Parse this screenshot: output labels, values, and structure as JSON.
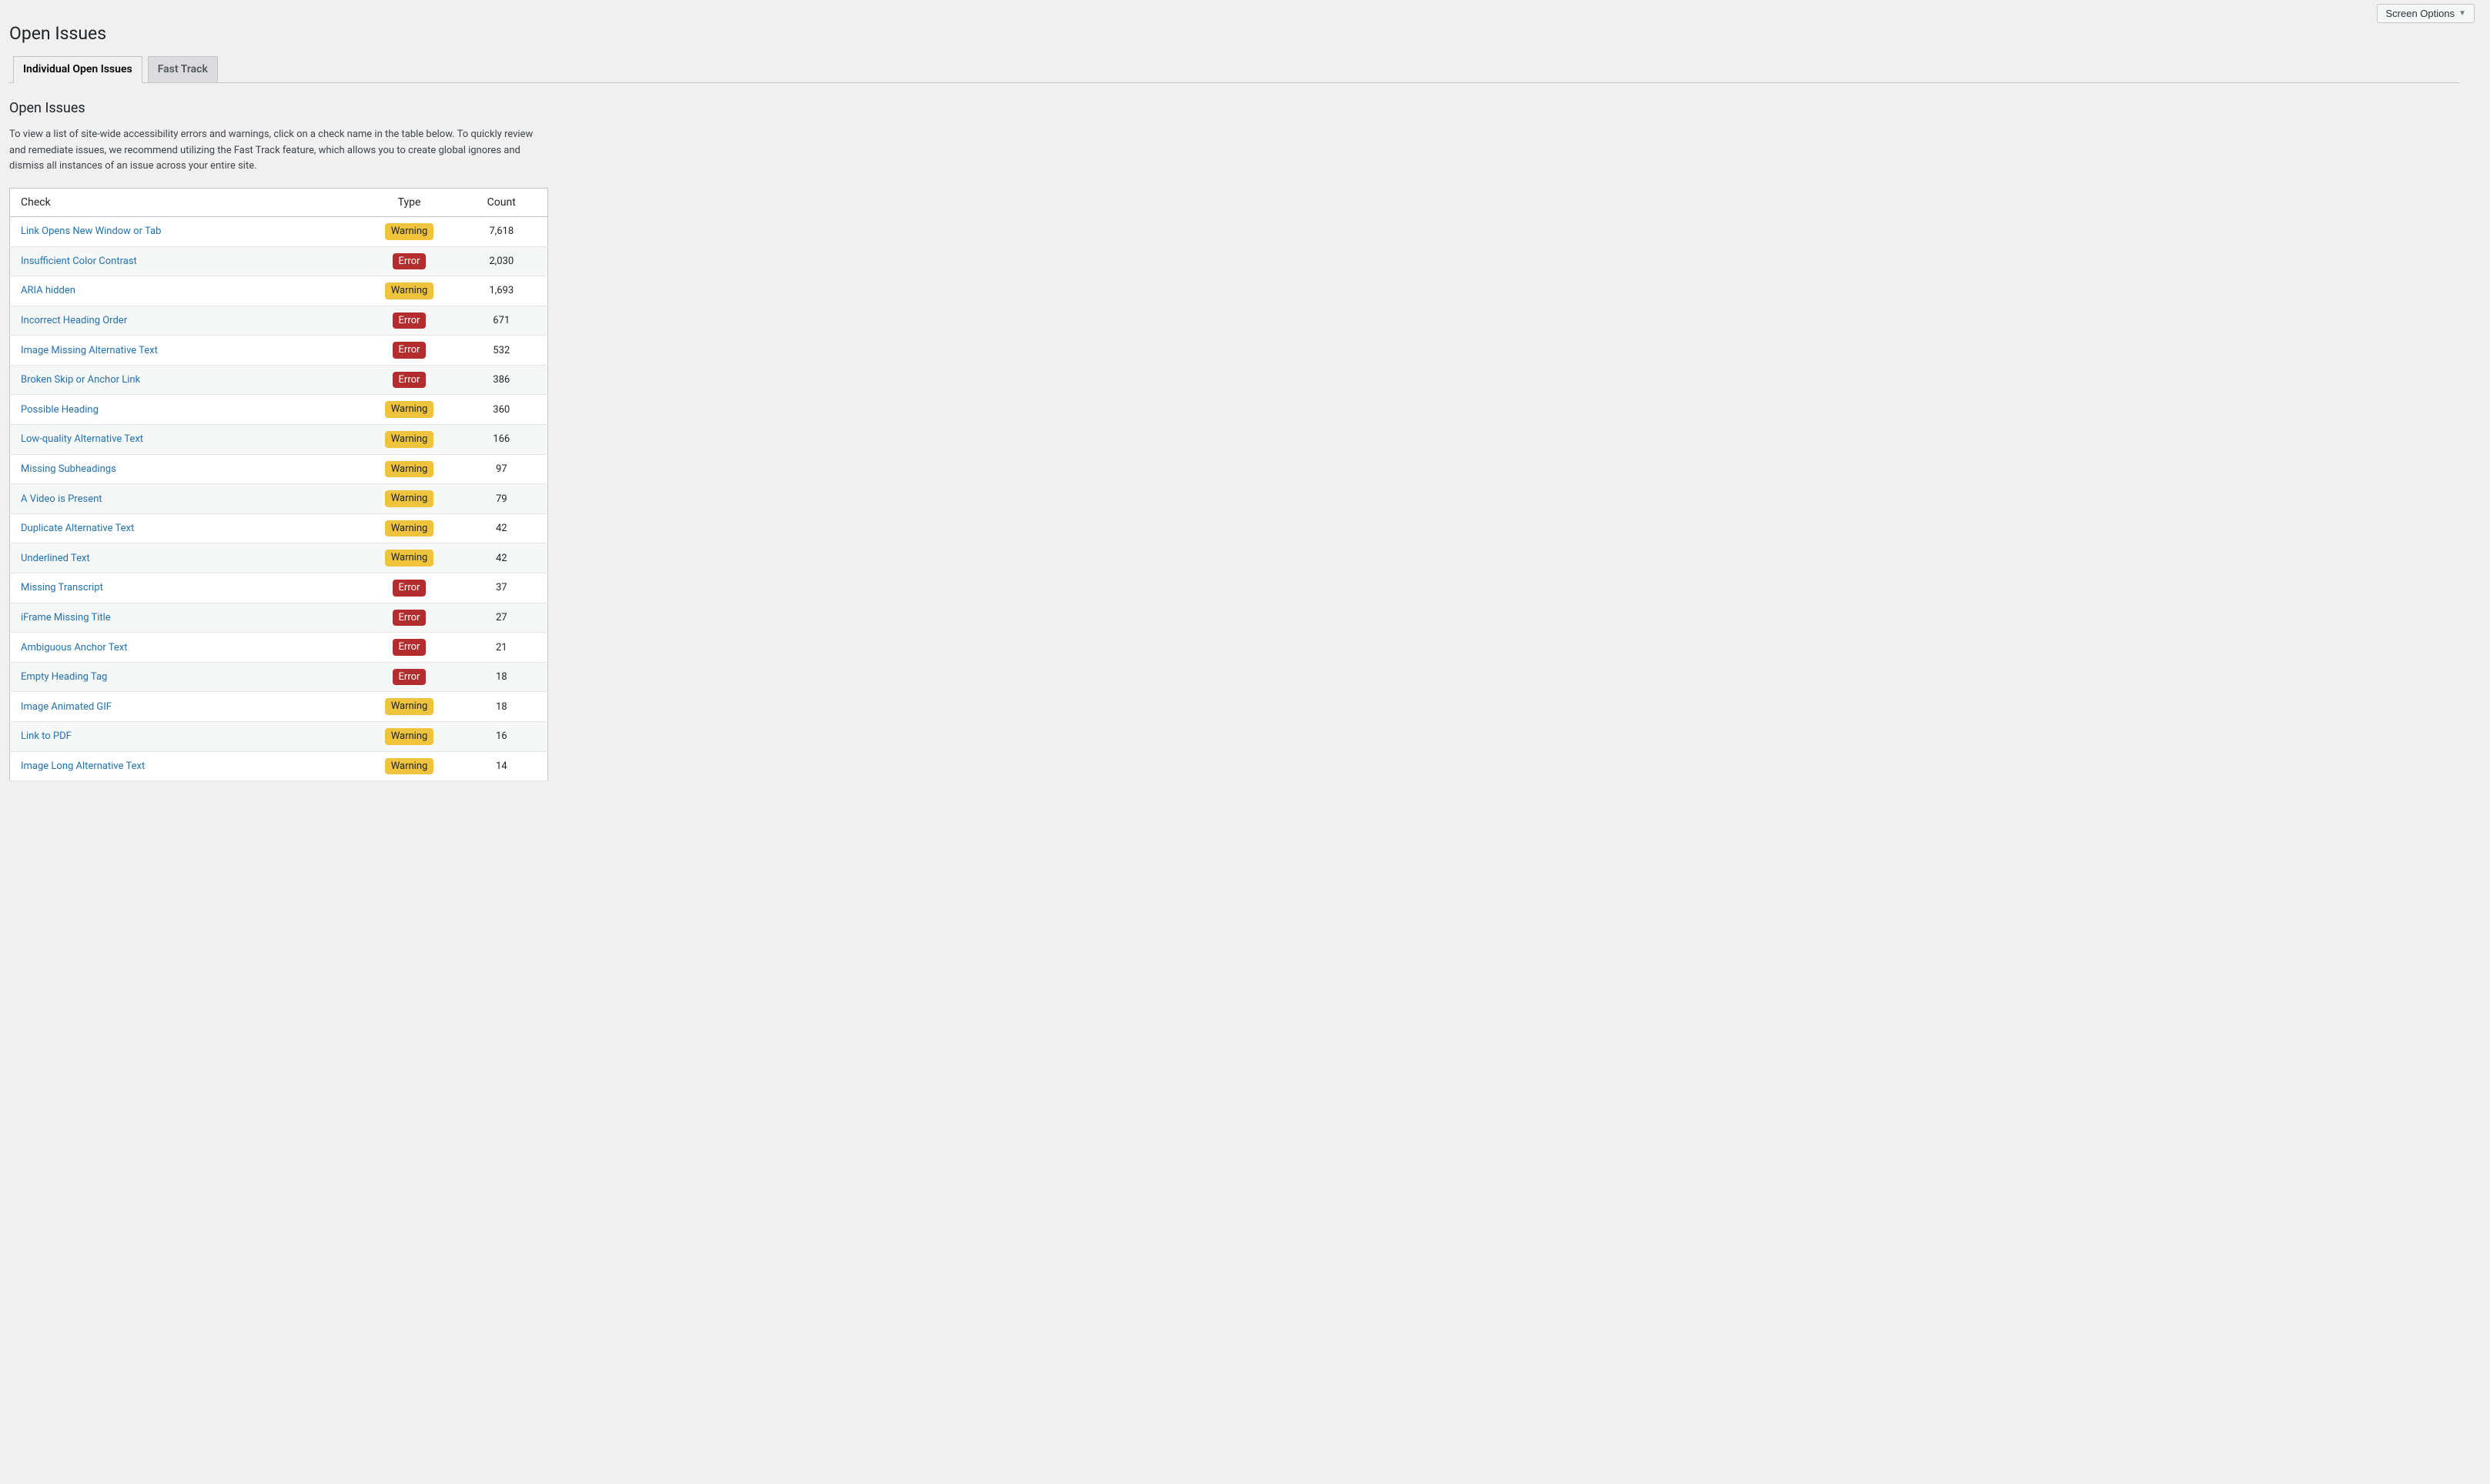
{
  "screen_options_label": "Screen Options",
  "page_title": "Open Issues",
  "tabs": [
    {
      "label": "Individual Open Issues",
      "active": true
    },
    {
      "label": "Fast Track",
      "active": false
    }
  ],
  "section_title": "Open Issues",
  "intro_text": "To view a list of site-wide accessibility errors and warnings, click on a check name in the table below. To quickly review and remediate issues, we recommend utilizing the Fast Track feature, which allows you to create global ignores and dismiss all instances of an issue across your entire site.",
  "table_headers": {
    "check": "Check",
    "type": "Type",
    "count": "Count"
  },
  "type_labels": {
    "warning": "Warning",
    "error": "Error"
  },
  "rows": [
    {
      "check": "Link Opens New Window or Tab",
      "type": "warning",
      "count": "7,618"
    },
    {
      "check": "Insufficient Color Contrast",
      "type": "error",
      "count": "2,030"
    },
    {
      "check": "ARIA hidden",
      "type": "warning",
      "count": "1,693"
    },
    {
      "check": "Incorrect Heading Order",
      "type": "error",
      "count": "671"
    },
    {
      "check": "Image Missing Alternative Text",
      "type": "error",
      "count": "532"
    },
    {
      "check": "Broken Skip or Anchor Link",
      "type": "error",
      "count": "386"
    },
    {
      "check": "Possible Heading",
      "type": "warning",
      "count": "360"
    },
    {
      "check": "Low-quality Alternative Text",
      "type": "warning",
      "count": "166"
    },
    {
      "check": "Missing Subheadings",
      "type": "warning",
      "count": "97"
    },
    {
      "check": "A Video is Present",
      "type": "warning",
      "count": "79"
    },
    {
      "check": "Duplicate Alternative Text",
      "type": "warning",
      "count": "42"
    },
    {
      "check": "Underlined Text",
      "type": "warning",
      "count": "42"
    },
    {
      "check": "Missing Transcript",
      "type": "error",
      "count": "37"
    },
    {
      "check": "iFrame Missing Title",
      "type": "error",
      "count": "27"
    },
    {
      "check": "Ambiguous Anchor Text",
      "type": "error",
      "count": "21"
    },
    {
      "check": "Empty Heading Tag",
      "type": "error",
      "count": "18"
    },
    {
      "check": "Image Animated GIF",
      "type": "warning",
      "count": "18"
    },
    {
      "check": "Link to PDF",
      "type": "warning",
      "count": "16"
    },
    {
      "check": "Image Long Alternative Text",
      "type": "warning",
      "count": "14"
    }
  ]
}
